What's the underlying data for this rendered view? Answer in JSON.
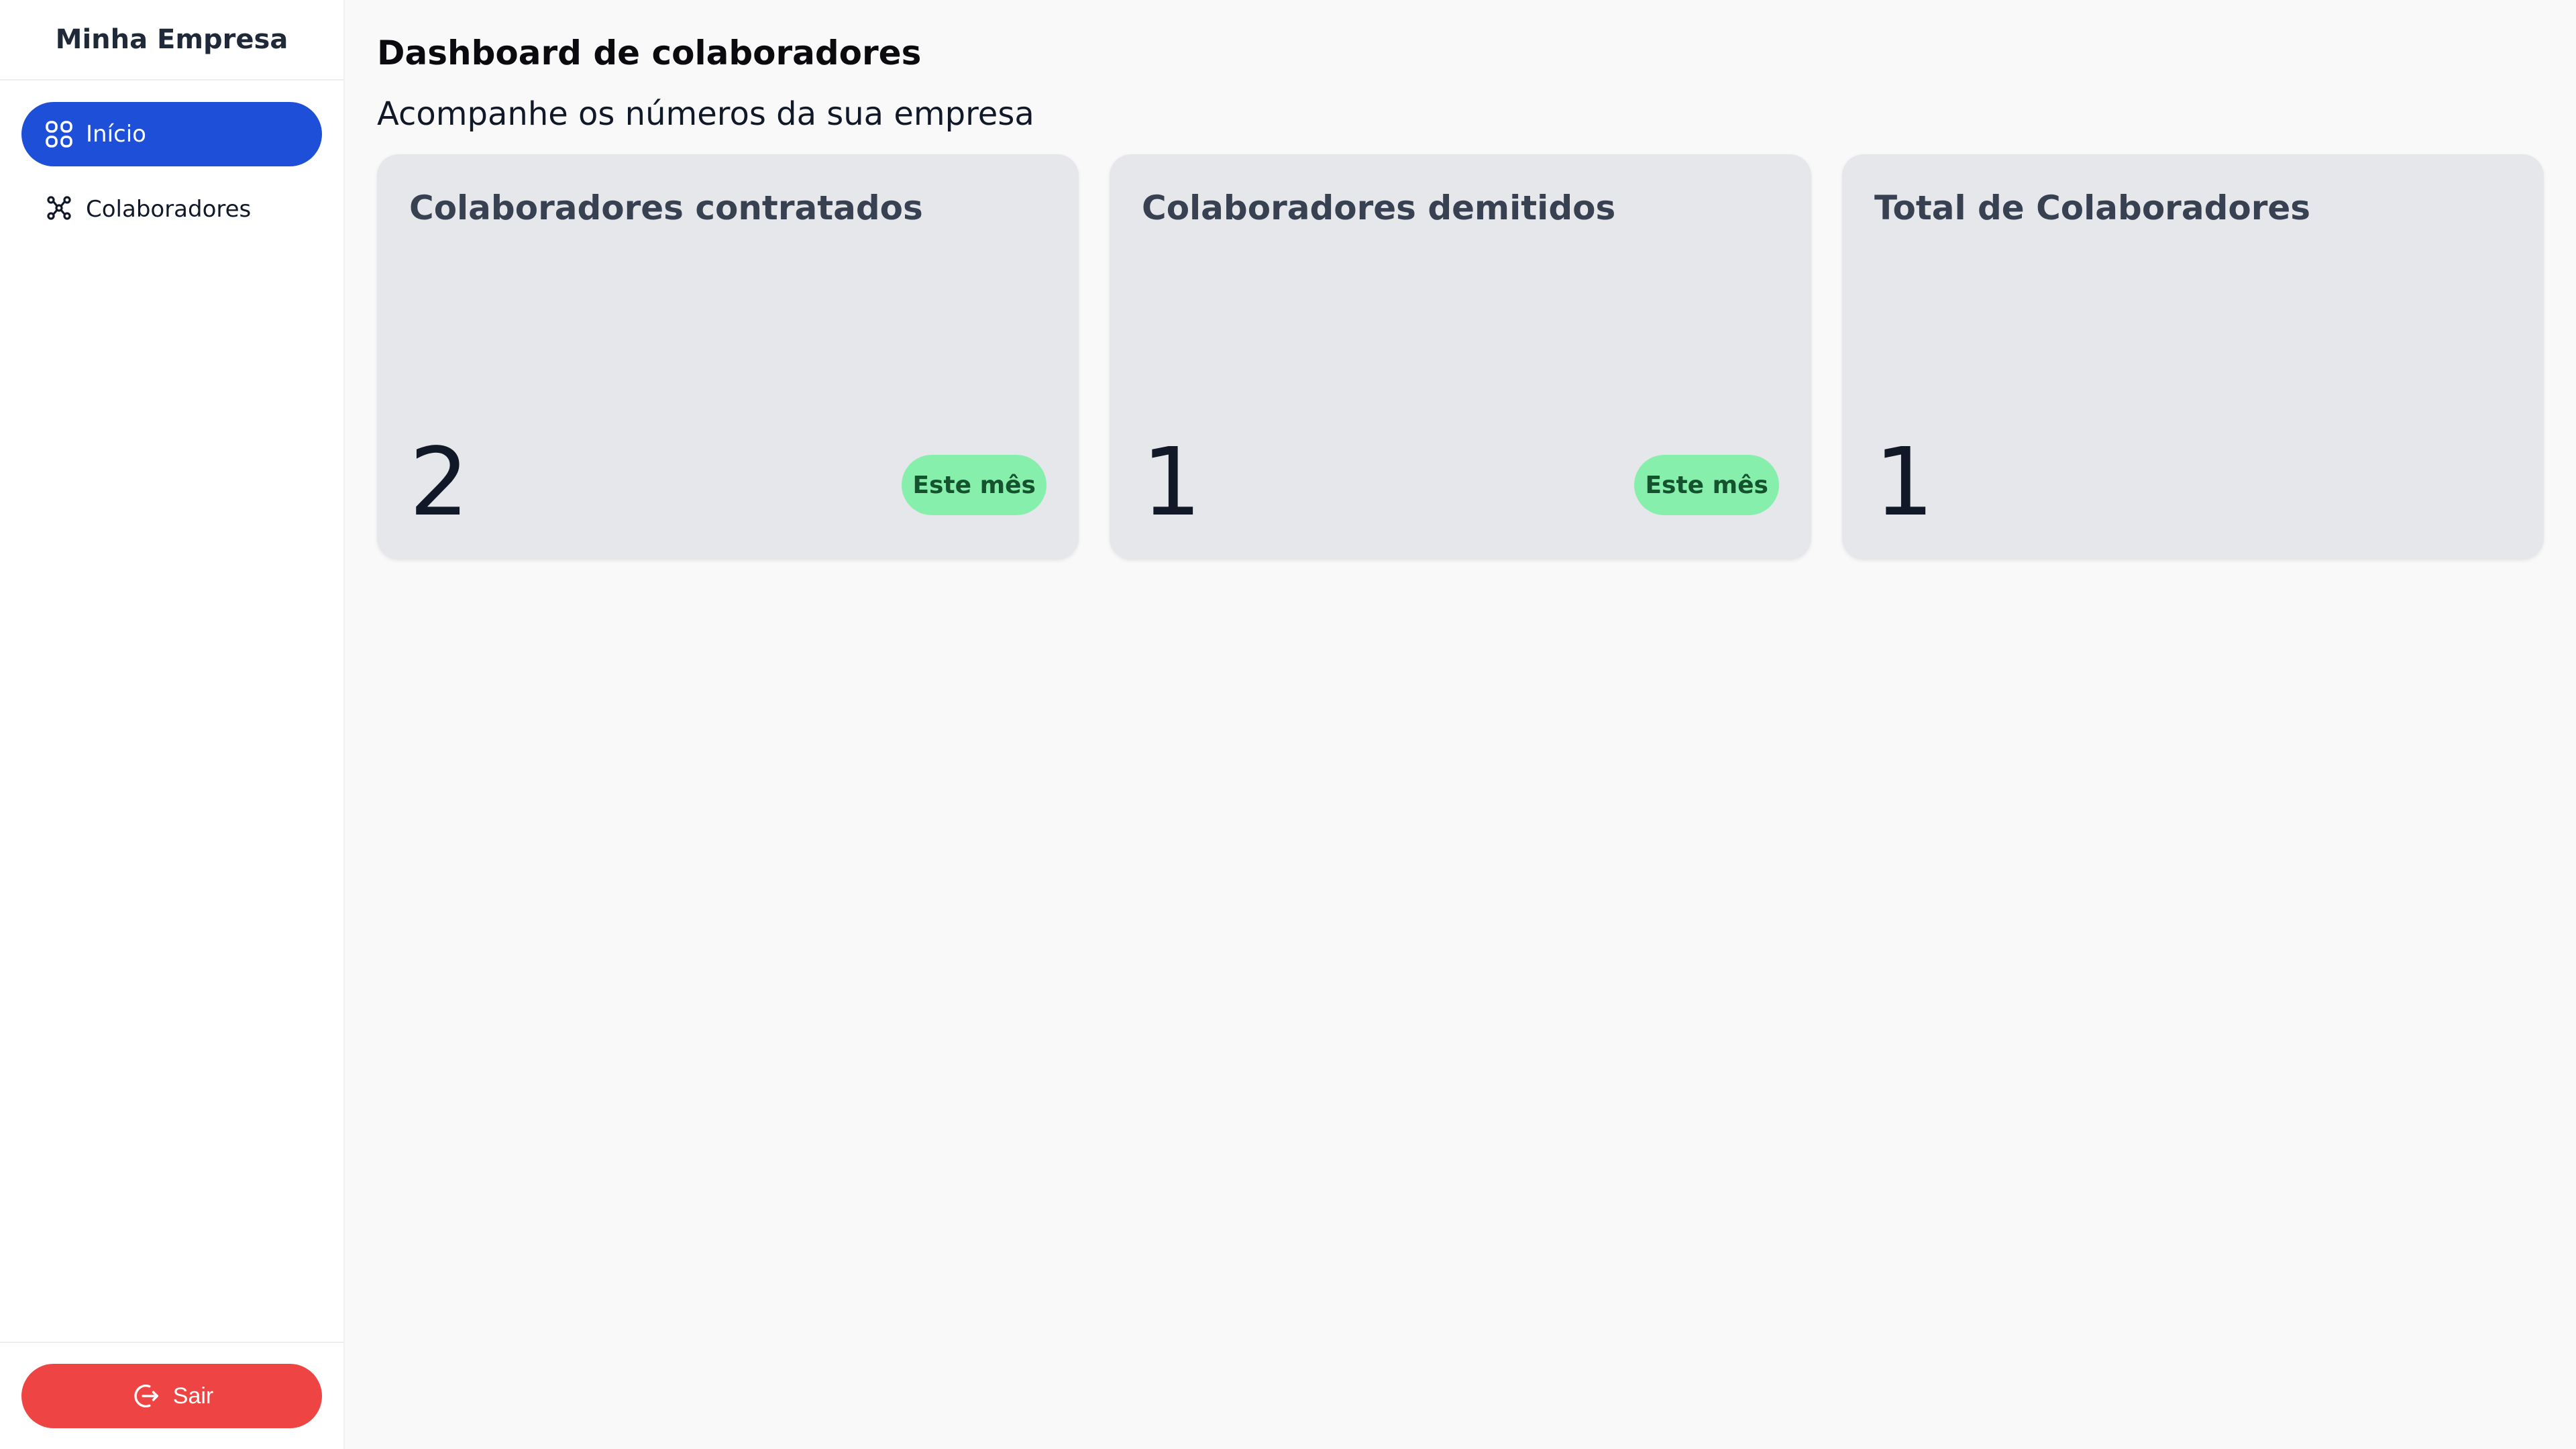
{
  "app": {
    "brand": "Minha Empresa"
  },
  "sidebar": {
    "items": [
      {
        "label": "Início",
        "icon": "grid-icon",
        "active": true
      },
      {
        "label": "Colaboradores",
        "icon": "people-network-icon",
        "active": false
      }
    ],
    "logout_label": "Sair",
    "logout_icon": "logout-icon"
  },
  "main": {
    "title": "Dashboard de colaboradores",
    "subtitle": "Acompanhe os números da sua empresa",
    "cards": [
      {
        "title": "Colaboradores contratados",
        "value": "2",
        "badge": "Este mês"
      },
      {
        "title": "Colaboradores demitidos",
        "value": "1",
        "badge": "Este mês"
      },
      {
        "title": "Total de Colaboradores",
        "value": "1"
      }
    ]
  },
  "colors": {
    "primary": "#1d4fd8",
    "danger": "#ef4444",
    "badge_bg": "#86efac",
    "card_bg": "#e6e7eb",
    "page_bg": "#f9f9f9"
  }
}
